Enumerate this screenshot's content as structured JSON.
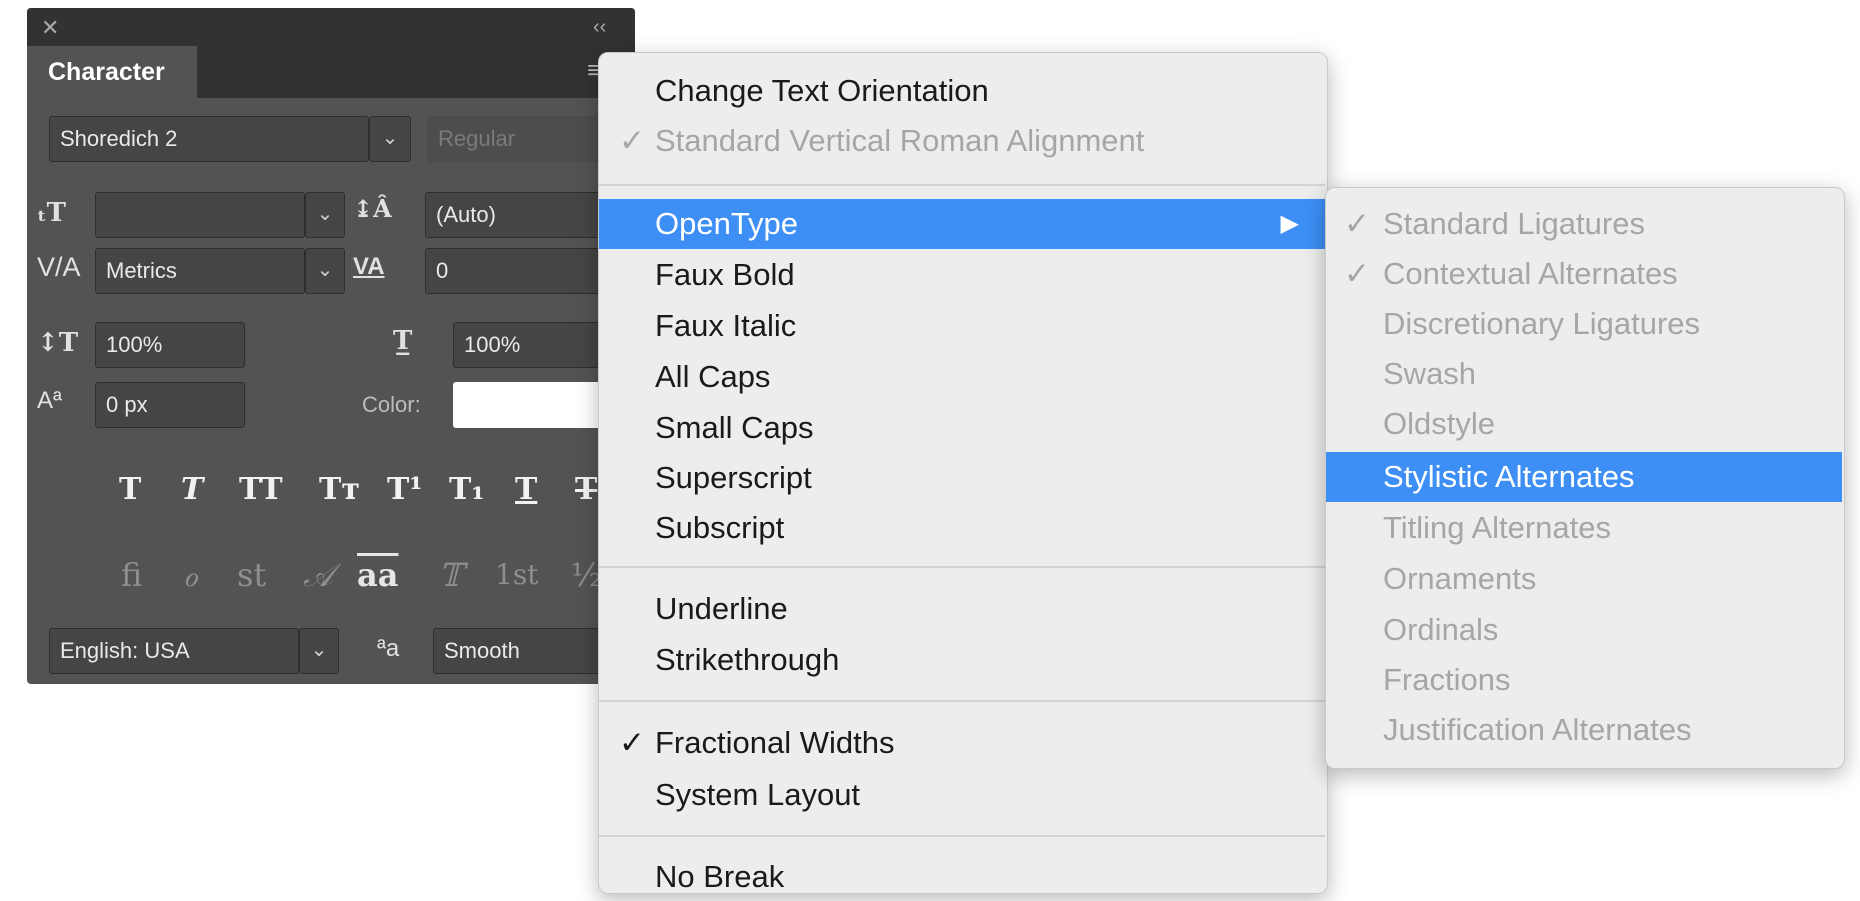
{
  "panel": {
    "close_glyph": "✕",
    "collapse_glyph": "‹‹",
    "menu_glyph": "≡",
    "tab_label": "Character",
    "font_family": "Shoredich 2",
    "font_style": "Regular",
    "font_size": "",
    "leading": "(Auto)",
    "kerning": "Metrics",
    "tracking": "0",
    "vertical_scale": "100%",
    "horizontal_scale": "100%",
    "baseline_shift": "0 px",
    "color_label": "Color:",
    "color_value": "#ffffff",
    "dropdown_glyph": "⌄",
    "style_buttons": [
      "T",
      "T",
      "TT",
      "Tт",
      "T¹",
      "T₁",
      "T",
      "T"
    ],
    "opentype_buttons": [
      "ﬁ",
      "ℴ",
      "st",
      "𝒜",
      "aa",
      "𝕋",
      "1st",
      "½"
    ],
    "language": "English: USA",
    "aa_icon": "ªa",
    "antialias": "Smooth"
  },
  "menu": {
    "check_glyph": "✓",
    "submenu_arrow": "▶",
    "items": [
      {
        "label": "Change Text Orientation"
      },
      {
        "label": "Standard Vertical Roman Alignment"
      },
      {
        "label": "OpenType"
      },
      {
        "label": "Faux Bold"
      },
      {
        "label": "Faux Italic"
      },
      {
        "label": "All Caps"
      },
      {
        "label": "Small Caps"
      },
      {
        "label": "Superscript"
      },
      {
        "label": "Subscript"
      },
      {
        "label": "Underline"
      },
      {
        "label": "Strikethrough"
      },
      {
        "label": "Fractional Widths"
      },
      {
        "label": "System Layout"
      },
      {
        "label": "No Break"
      }
    ]
  },
  "submenu": {
    "items": [
      {
        "label": "Standard Ligatures"
      },
      {
        "label": "Contextual Alternates"
      },
      {
        "label": "Discretionary Ligatures"
      },
      {
        "label": "Swash"
      },
      {
        "label": "Oldstyle"
      },
      {
        "label": "Stylistic Alternates"
      },
      {
        "label": "Titling Alternates"
      },
      {
        "label": "Ornaments"
      },
      {
        "label": "Ordinals"
      },
      {
        "label": "Fractions"
      },
      {
        "label": "Justification Alternates"
      }
    ]
  },
  "colors": {
    "panel_bg": "#535353",
    "highlight": "#3d8ff6",
    "menu_bg": "#ededed"
  }
}
